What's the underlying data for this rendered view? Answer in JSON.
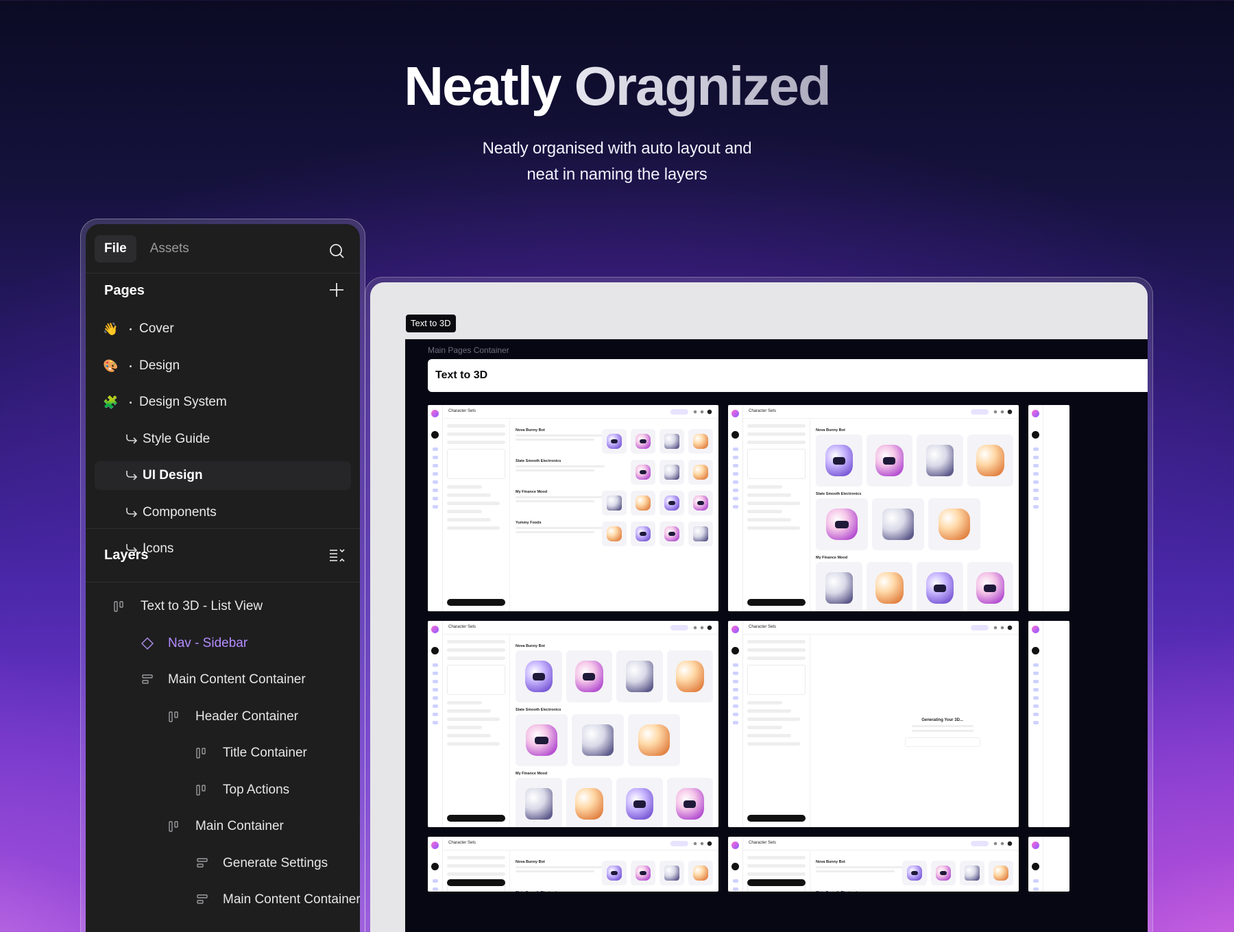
{
  "hero": {
    "title_part1": "Neatly",
    "title_part2": "Oragnized",
    "subtitle_line1": "Neatly organised with auto layout and",
    "subtitle_line2": "neat in naming the layers"
  },
  "panel": {
    "tabs": [
      {
        "label": "File",
        "active": true
      },
      {
        "label": "Assets",
        "active": false
      }
    ],
    "pages_title": "Pages",
    "pages": [
      {
        "emoji": "👋",
        "label": "Cover",
        "type": "page"
      },
      {
        "emoji": "🎨",
        "label": "Design",
        "type": "page"
      },
      {
        "emoji": "🧩",
        "label": "Design System",
        "type": "page"
      },
      {
        "label": "Style Guide",
        "type": "sub"
      },
      {
        "label": "UI Design",
        "type": "sub",
        "selected": true
      },
      {
        "label": "Components",
        "type": "sub"
      },
      {
        "label": "Icons",
        "type": "sub"
      }
    ],
    "layers_title": "Layers",
    "layers": [
      {
        "label": "Text to 3D - List View",
        "icon": "auto-layout-horizontal-icon",
        "depth": 0
      },
      {
        "label": "Nav - Sidebar",
        "icon": "component-instance-icon",
        "depth": 1,
        "component": true
      },
      {
        "label": "Main Content Container",
        "icon": "auto-layout-vertical-icon",
        "depth": 1
      },
      {
        "label": "Header Container",
        "icon": "auto-layout-horizontal-icon",
        "depth": 2
      },
      {
        "label": "Title Container",
        "icon": "auto-layout-horizontal-icon",
        "depth": 3
      },
      {
        "label": "Top Actions",
        "icon": "auto-layout-horizontal-icon",
        "depth": 3
      },
      {
        "label": "Main Container",
        "icon": "auto-layout-horizontal-icon",
        "depth": 2
      },
      {
        "label": "Generate Settings",
        "icon": "auto-layout-vertical-icon",
        "depth": 3
      },
      {
        "label": "Main Content Container",
        "icon": "auto-layout-vertical-icon",
        "depth": 3
      }
    ]
  },
  "canvas": {
    "frame_tag": "Text to 3D",
    "area_label": "Main Pages Container",
    "header_title": "Text to 3D",
    "thumb_crumb": "Character Sets",
    "section_labels": [
      "Nova Bunny Bot",
      "Slate Smooth Electronics",
      "My Finance Mood",
      "Yummy Foods"
    ],
    "generating_text": "Generating Your 3D..."
  },
  "colors": {
    "panel_bg": "#1e1e1f",
    "component_accent": "#b48cff",
    "canvas_bg": "#060712"
  }
}
